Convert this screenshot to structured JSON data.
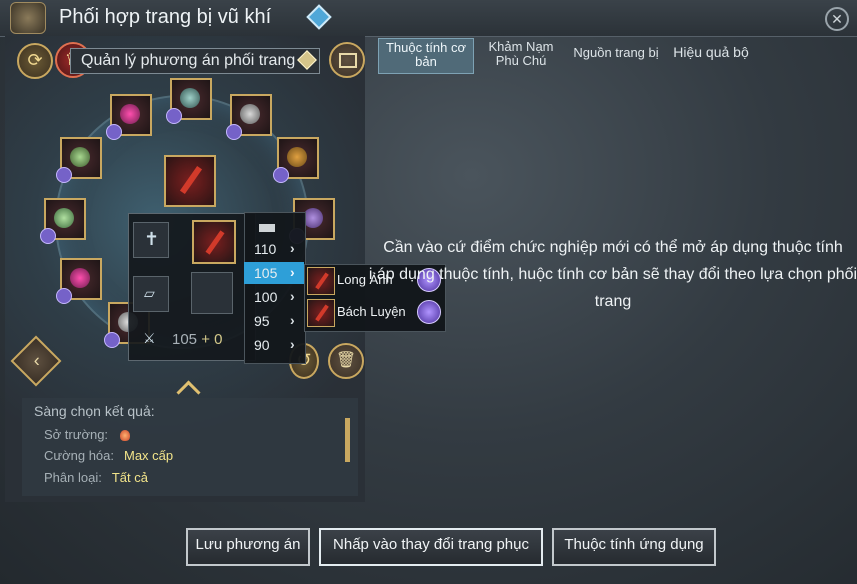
{
  "window": {
    "title": "Phối hợp trang bị vũ khí",
    "close_icon": "close-icon"
  },
  "scheme": {
    "label": "Quản lý phương án phối trang"
  },
  "tabs": [
    {
      "label": "Thuộc tính cơ bản"
    },
    {
      "label": "Khảm Nạm Phù Chú"
    },
    {
      "label": "Nguồn trang bị"
    },
    {
      "label": "Hiệu quả bộ"
    }
  ],
  "refine": {
    "level": "105",
    "plus": "+",
    "bonus": "0"
  },
  "level_menu": {
    "selected": "105",
    "items": [
      "110",
      "105",
      "100",
      "95",
      "90"
    ]
  },
  "variants": [
    {
      "name": "Long Ảnh"
    },
    {
      "name": "Bách Luyện"
    }
  ],
  "info": {
    "line1": "Cần vào cứ điểm chức nghiệp mới có thể mở áp dụng thuộc tính",
    "line2": "i áp dụng thuộc tính, huộc tính cơ bản sẽ thay đổi theo lựa chọn phối trang"
  },
  "filter": {
    "title": "Sàng chọn kết quả:",
    "specialty_label": "Sở trường:",
    "enhance_label": "Cường hóa:",
    "enhance_value": "Max cấp",
    "category_label": "Phân loại:",
    "category_value": "Tất cả"
  },
  "footer": {
    "save": "Lưu phương án",
    "change": "Nhấp vào thay đổi trang phục",
    "apply": "Thuộc tính ứng dụng"
  },
  "colors": {
    "accent": "#2e9fd8",
    "gold": "#c9a860",
    "highlight_text": "#f2e48a"
  }
}
